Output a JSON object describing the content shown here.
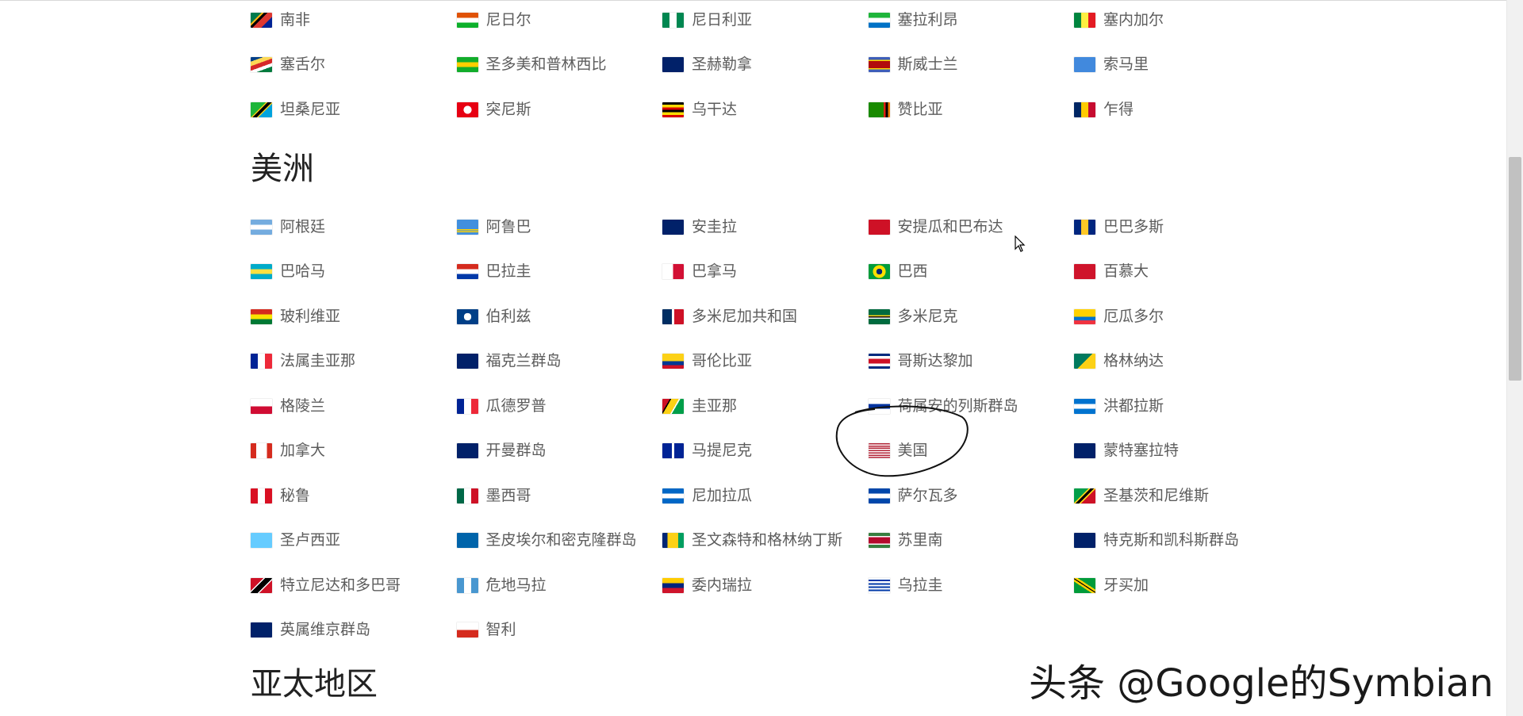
{
  "regions": [
    {
      "title": "",
      "countries": [
        {
          "name": "南非",
          "flag": "linear-gradient(135deg,#007a4d 0 30%,#ffb612 30% 36%,#000 36% 46%,#de3831 46% 70%,#002395 70% 100%)"
        },
        {
          "name": "尼日尔",
          "flag": "linear-gradient(#e05206 0 33%,#fff 33% 66%,#0db02b 66% 100%)"
        },
        {
          "name": "尼日利亚",
          "flag": "linear-gradient(90deg,#008751 0 33%,#fff 33% 66%,#008751 66% 100%)"
        },
        {
          "name": "塞拉利昂",
          "flag": "linear-gradient(#1eb53a 0 33%,#fff 33% 66%,#0072c6 66% 100%)"
        },
        {
          "name": "塞内加尔",
          "flag": "linear-gradient(90deg,#00853f 0 33%,#fdef42 33% 66%,#e31b23 66% 100%)"
        },
        {
          "name": "塞舌尔",
          "flag": "linear-gradient(160deg,#003f87 0 20%,#fcd856 20% 40%,#d62828 40% 60%,#fff 60% 75%,#007a3d 75% 100%)"
        },
        {
          "name": "圣多美和普林西比",
          "flag": "linear-gradient(#12ad2b 0 33%,#ffce00 33% 66%,#12ad2b 66% 100%)"
        },
        {
          "name": "圣赫勒拿",
          "flag": "linear-gradient(#012169 0 100%)"
        },
        {
          "name": "斯威士兰",
          "flag": "linear-gradient(#3e5eb9 0 18%,#ffd900 18% 26%,#b10c0c 26% 74%,#ffd900 74% 82%,#3e5eb9 82% 100%)"
        },
        {
          "name": "索马里",
          "flag": "linear-gradient(#4189dd 0 100%)"
        },
        {
          "name": "坦桑尼亚",
          "flag": "linear-gradient(135deg,#1eb53a 0 42%,#fcd116 42% 46%,#000 46% 58%,#fcd116 58% 62%,#00a3dd 62% 100%)"
        },
        {
          "name": "突尼斯",
          "flag": "radial-gradient(circle at 50% 50%,#fff 0 30%,#e70013 31% 100%)"
        },
        {
          "name": "乌干达",
          "flag": "linear-gradient(#000 0 17%,#fcdc04 17% 33%,#d90000 33% 50%,#000 50% 67%,#fcdc04 67% 83%,#d90000 83% 100%)"
        },
        {
          "name": "赞比亚",
          "flag": "linear-gradient(90deg,#198a00 0 70%,#de2010 70% 80%,#000 80% 90%,#ef7d00 90% 100%)"
        },
        {
          "name": "乍得",
          "flag": "linear-gradient(90deg,#002664 0 33%,#fecb00 33% 66%,#c60c30 66% 100%)"
        }
      ]
    },
    {
      "title": "美洲",
      "countries": [
        {
          "name": "阿根廷",
          "flag": "linear-gradient(#74acdf 0 33%,#fff 33% 66%,#74acdf 66% 100%)"
        },
        {
          "name": "阿鲁巴",
          "flag": "linear-gradient(#418fde 0 62%,#ffd100 62% 70%,#418fde 70% 76%,#ffd100 76% 84%,#418fde 84% 100%)"
        },
        {
          "name": "安圭拉",
          "flag": "linear-gradient(#012169 0 100%)"
        },
        {
          "name": "安提瓜和巴布达",
          "flag": "linear-gradient(#ce1126 0 100%)"
        },
        {
          "name": "巴巴多斯",
          "flag": "linear-gradient(90deg,#00267f 0 33%,#ffc726 33% 66%,#00267f 66% 100%)"
        },
        {
          "name": "巴哈马",
          "flag": "linear-gradient(#00abc9 0 33%,#fae042 33% 66%,#00abc9 66% 100%)"
        },
        {
          "name": "巴拉圭",
          "flag": "linear-gradient(#d52b1e 0 33%,#fff 33% 66%,#0038a8 66% 100%)"
        },
        {
          "name": "巴拿马",
          "flag": "linear-gradient(90deg,#fff 0 50%,#d21034 50% 100%)"
        },
        {
          "name": "巴西",
          "flag": "radial-gradient(circle at 50% 50%,#002776 0 22%,#ffdf00 23% 48%,#009c3b 49% 100%)"
        },
        {
          "name": "百慕大",
          "flag": "linear-gradient(#cf142b 0 100%)"
        },
        {
          "name": "玻利维亚",
          "flag": "linear-gradient(#d52b1e 0 33%,#f9e300 33% 66%,#007934 66% 100%)"
        },
        {
          "name": "伯利兹",
          "flag": "radial-gradient(circle at 50% 50%,#fff 0 28%,#003f87 29% 100%)"
        },
        {
          "name": "多米尼加共和国",
          "flag": "linear-gradient(90deg,#002d62 0 45%,#fff 45% 55%,#ce1126 55% 100%)"
        },
        {
          "name": "多米尼克",
          "flag": "linear-gradient(#006b3f 0 40%,#fcd116 40% 48%,#000 48% 54%,#fff 54% 62%,#006b3f 62% 100%)"
        },
        {
          "name": "厄瓜多尔",
          "flag": "linear-gradient(#ffd100 0 50%,#0072ce 50% 75%,#ef3340 75% 100%)"
        },
        {
          "name": "法属圭亚那",
          "flag": "linear-gradient(90deg,#002395 0 33%,#fff 33% 66%,#ed2939 66% 100%)"
        },
        {
          "name": "福克兰群岛",
          "flag": "linear-gradient(#012169 0 100%)"
        },
        {
          "name": "哥伦比亚",
          "flag": "linear-gradient(#fcd116 0 50%,#003893 50% 75%,#ce1126 75% 100%)"
        },
        {
          "name": "哥斯达黎加",
          "flag": "linear-gradient(#002b7f 0 17%,#fff 17% 33%,#ce1126 33% 67%,#fff 67% 83%,#002b7f 83% 100%)"
        },
        {
          "name": "格林纳达",
          "flag": "linear-gradient(135deg,#007a5e 0 50%,#fcd116 50% 100%)"
        },
        {
          "name": "格陵兰",
          "flag": "linear-gradient(#fff 0 50%,#d00c33 50% 100%)"
        },
        {
          "name": "瓜德罗普",
          "flag": "linear-gradient(90deg,#002395 0 33%,#fff 33% 66%,#ed2939 66% 100%)"
        },
        {
          "name": "圭亚那",
          "flag": "linear-gradient(120deg,#ce1126 0 25%,#000 25% 30%,#fcd116 30% 55%,#fff 55% 60%,#009e49 60% 100%)"
        },
        {
          "name": "荷属安的列斯群岛",
          "flag": "linear-gradient(#fff 0 35%,#0033a0 35% 65%,#fff 65% 100%)"
        },
        {
          "name": "洪都拉斯",
          "flag": "linear-gradient(#0073cf 0 33%,#fff 33% 66%,#0073cf 66% 100%)"
        },
        {
          "name": "加拿大",
          "flag": "linear-gradient(90deg,#d52b1e 0 25%,#fff 25% 75%,#d52b1e 75% 100%)"
        },
        {
          "name": "开曼群岛",
          "flag": "linear-gradient(#012169 0 100%)"
        },
        {
          "name": "马提尼克",
          "flag": "linear-gradient(90deg,#002395 0 45%,#fff 45% 55%,#002395 55% 100%)"
        },
        {
          "name": "美国",
          "flag": "repeating-linear-gradient(#b22234 0 8%,#fff 8% 15%)"
        },
        {
          "name": "蒙特塞拉特",
          "flag": "linear-gradient(#012169 0 100%)"
        },
        {
          "name": "秘鲁",
          "flag": "linear-gradient(90deg,#d91023 0 33%,#fff 33% 66%,#d91023 66% 100%)"
        },
        {
          "name": "墨西哥",
          "flag": "linear-gradient(90deg,#006847 0 33%,#fff 33% 66%,#ce1126 66% 100%)"
        },
        {
          "name": "尼加拉瓜",
          "flag": "linear-gradient(#0067c6 0 33%,#fff 33% 66%,#0067c6 66% 100%)"
        },
        {
          "name": "萨尔瓦多",
          "flag": "linear-gradient(#0047ab 0 33%,#fff 33% 66%,#0047ab 66% 100%)"
        },
        {
          "name": "圣基茨和尼维斯",
          "flag": "linear-gradient(135deg,#009e49 0 40%,#fcd116 40% 45%,#000 45% 55%,#fcd116 55% 60%,#ce1126 60% 100%)"
        },
        {
          "name": "圣卢西亚",
          "flag": "linear-gradient(#66ccff 0 100%)"
        },
        {
          "name": "圣皮埃尔和密克隆群岛",
          "flag": "linear-gradient(#0064aa 0 100%)"
        },
        {
          "name": "圣文森特和格林纳丁斯",
          "flag": "linear-gradient(90deg,#002674 0 25%,#fcd116 25% 75%,#009e60 75% 100%)"
        },
        {
          "name": "苏里南",
          "flag": "linear-gradient(#377e3f 0 20%,#fff 20% 30%,#b40a2d 30% 70%,#fff 70% 80%,#377e3f 80% 100%)"
        },
        {
          "name": "特克斯和凯科斯群岛",
          "flag": "linear-gradient(#012169 0 100%)"
        },
        {
          "name": "特立尼达和多巴哥",
          "flag": "linear-gradient(135deg,#ce1126 0 35%,#fff 35% 40%,#000 40% 60%,#fff 60% 65%,#ce1126 65% 100%)"
        },
        {
          "name": "危地马拉",
          "flag": "linear-gradient(90deg,#4997d0 0 33%,#fff 33% 66%,#4997d0 66% 100%)"
        },
        {
          "name": "委内瑞拉",
          "flag": "linear-gradient(#ffcc00 0 33%,#00247d 33% 66%,#cf142b 66% 100%)"
        },
        {
          "name": "乌拉圭",
          "flag": "repeating-linear-gradient(#fff 0 11%,#0038a8 11% 22%)"
        },
        {
          "name": "牙买加",
          "flag": "linear-gradient(33deg,#009b3a 0 40%,#fed100 40% 48%,#000 48% 52%,#fed100 52% 60%,#009b3a 60% 100%)"
        },
        {
          "name": "英属维京群岛",
          "flag": "linear-gradient(#012169 0 100%)"
        },
        {
          "name": "智利",
          "flag": "linear-gradient(#fff 0 50%,#d52b1e 50% 100%)"
        }
      ]
    },
    {
      "title": "亚太地区",
      "countries": []
    }
  ],
  "watermark": "头条 @Google的Symbian",
  "colors": {
    "text": "#5c5c5c",
    "heading": "#222222",
    "background": "#ffffff"
  }
}
